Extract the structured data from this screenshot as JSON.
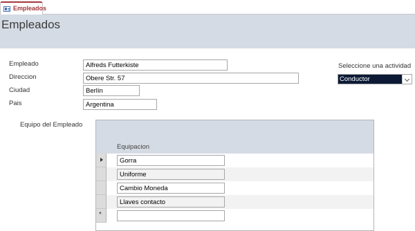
{
  "tab": {
    "label": "Empleados",
    "icon": "form-icon",
    "accent_color": "#a4373a"
  },
  "header": {
    "title": "Empleados",
    "background": "#d5dbe4"
  },
  "form": {
    "empleado": {
      "label": "Empleado",
      "value": "Alfreds Futterkiste"
    },
    "direccion": {
      "label": "Direccion",
      "value": "Obere Str. 57"
    },
    "ciudad": {
      "label": "Ciudad",
      "value": "Berlín"
    },
    "pais": {
      "label": "Pais",
      "value": "Argentina"
    }
  },
  "activity": {
    "label": "Seleccione una actividad",
    "selected": "Conductor"
  },
  "equipment": {
    "label": "Equipo del Empleado",
    "column": "Equipacion",
    "rows": [
      {
        "value": "Gorra"
      },
      {
        "value": "Uniforme"
      },
      {
        "value": "Cambio Moneda"
      },
      {
        "value": "Llaves contacto"
      },
      {
        "value": ""
      }
    ],
    "new_record_marker": "*"
  }
}
